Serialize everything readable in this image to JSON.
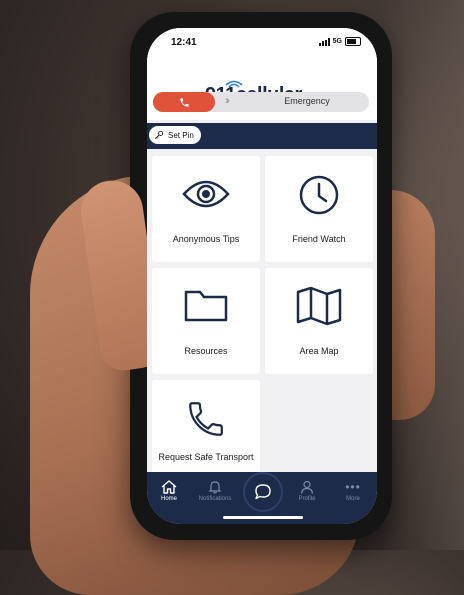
{
  "status_bar": {
    "time": "12:41",
    "network": "5G"
  },
  "header": {
    "logo_text": "911cellular"
  },
  "emergency": {
    "label": "Emergency",
    "button_icon": "phone-icon",
    "chevron_icon": "double-chevron-right-icon"
  },
  "pin": {
    "label": "Set Pin",
    "icon": "key-icon"
  },
  "tiles": [
    {
      "label": "Anonymous Tips",
      "icon": "eye-icon"
    },
    {
      "label": "Friend Watch",
      "icon": "clock-icon"
    },
    {
      "label": "Resources",
      "icon": "folder-icon"
    },
    {
      "label": "Area Map",
      "icon": "map-icon"
    },
    {
      "label": "Request Safe Transport",
      "icon": "phone-icon"
    }
  ],
  "tabs": [
    {
      "label": "Home",
      "icon": "home-icon",
      "active": true
    },
    {
      "label": "Notifications",
      "icon": "bell-icon",
      "active": false
    },
    {
      "label": "Profile",
      "icon": "person-icon",
      "active": false
    },
    {
      "label": "More",
      "icon": "more-dots-icon",
      "active": false
    }
  ],
  "center_action": {
    "icon": "chat-bubble-icon"
  },
  "colors": {
    "navy": "#1c2b4a",
    "emergency_red": "#e0533a",
    "screen_bg": "#f1f1f3"
  }
}
